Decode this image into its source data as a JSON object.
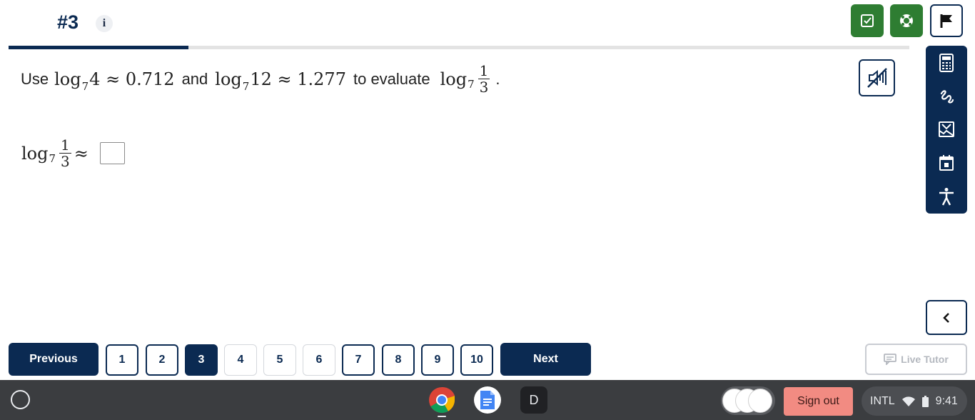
{
  "header": {
    "question_number": "#3",
    "info_label": "i",
    "progress_fraction": 0.2
  },
  "question": {
    "intro": "Use",
    "given1": {
      "log": "log",
      "base": "7",
      "arg": "4",
      "approx": "≈",
      "value": "0.712"
    },
    "connector": "and",
    "given2": {
      "log": "log",
      "base": "7",
      "arg": "12",
      "approx": "≈",
      "value": "1.277"
    },
    "task": "to evaluate",
    "target": {
      "log": "log",
      "base": "7",
      "num": "1",
      "den": "3"
    },
    "period": "."
  },
  "answer": {
    "log": "log",
    "base": "7",
    "num": "1",
    "den": "3",
    "approx": "≈",
    "value": ""
  },
  "navigation": {
    "previous_label": "Previous",
    "next_label": "Next",
    "pages": [
      "1",
      "2",
      "3",
      "4",
      "5",
      "6",
      "7",
      "8",
      "9",
      "10"
    ],
    "current_page": "3"
  },
  "live_tutor_label": "Live Tutor",
  "taskbar": {
    "signout_label": "Sign out",
    "input_method": "INTL",
    "time": "9:41",
    "d_app_label": "D"
  },
  "colors": {
    "navy": "#0b2a52",
    "green": "#2e7d32",
    "signout": "#f28b82",
    "taskbar": "#3b3d40"
  },
  "icons": [
    "info-icon",
    "check-icon",
    "help-lifebuoy-icon",
    "flag-icon",
    "mute-icon",
    "calculator-icon",
    "pen-icon",
    "image-icon",
    "calendar-icon",
    "accessibility-icon",
    "chevron-left-icon",
    "chat-icon",
    "launcher-icon",
    "chrome-icon",
    "docs-icon",
    "wifi-icon",
    "battery-icon"
  ]
}
